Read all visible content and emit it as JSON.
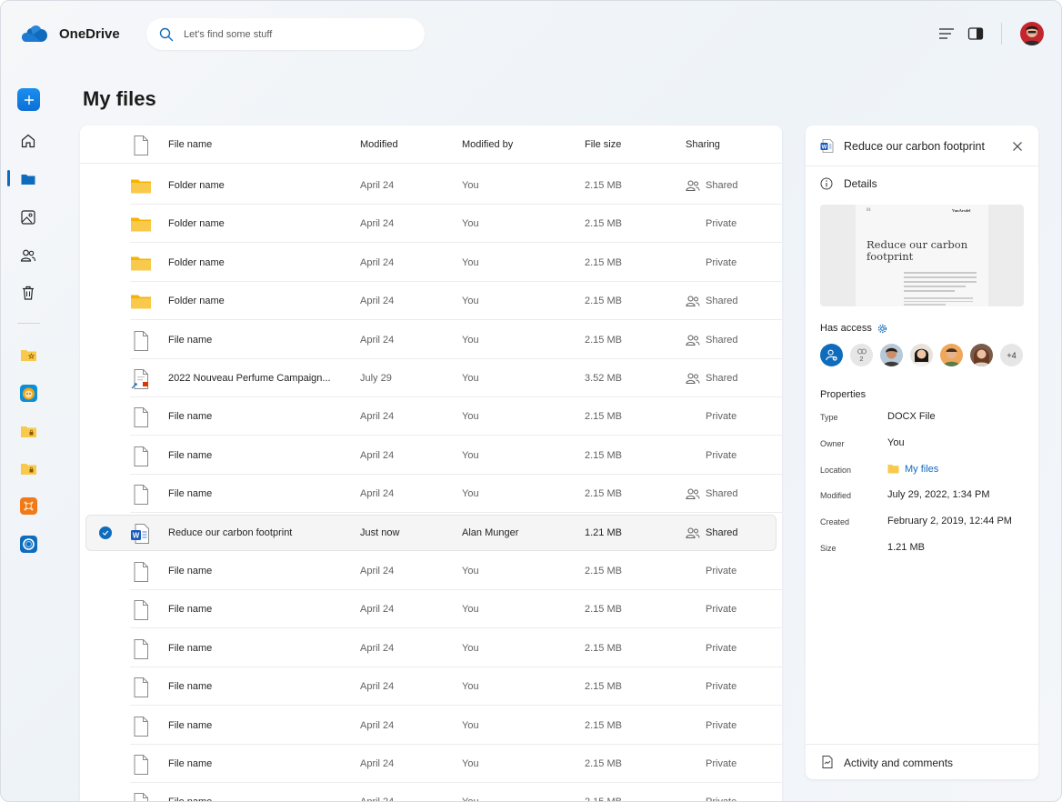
{
  "app": {
    "title": "OneDrive"
  },
  "search": {
    "placeholder": "Let's find some stuff"
  },
  "page": {
    "title": "My files"
  },
  "table": {
    "headers": {
      "name": "File name",
      "modified": "Modified",
      "modified_by": "Modified by",
      "size": "File size",
      "sharing": "Sharing"
    },
    "rows": [
      {
        "type": "folder",
        "name": "Folder name",
        "modified": "April 24",
        "by": "You",
        "size": "2.15 MB",
        "sharing": "Shared"
      },
      {
        "type": "folder",
        "name": "Folder name",
        "modified": "April 24",
        "by": "You",
        "size": "2.15 MB",
        "sharing": "Private"
      },
      {
        "type": "folder",
        "name": "Folder name",
        "modified": "April 24",
        "by": "You",
        "size": "2.15 MB",
        "sharing": "Private"
      },
      {
        "type": "folder",
        "name": "Folder name",
        "modified": "April 24",
        "by": "You",
        "size": "2.15 MB",
        "sharing": "Shared"
      },
      {
        "type": "file",
        "name": "File name",
        "modified": "April 24",
        "by": "You",
        "size": "2.15 MB",
        "sharing": "Shared"
      },
      {
        "type": "ppt",
        "name": "2022 Nouveau Perfume Campaign...",
        "modified": "July 29",
        "by": "You",
        "size": "3.52 MB",
        "sharing": "Shared"
      },
      {
        "type": "file",
        "name": "File name",
        "modified": "April 24",
        "by": "You",
        "size": "2.15 MB",
        "sharing": "Private"
      },
      {
        "type": "file",
        "name": "File name",
        "modified": "April 24",
        "by": "You",
        "size": "2.15 MB",
        "sharing": "Private"
      },
      {
        "type": "file",
        "name": "File name",
        "modified": "April 24",
        "by": "You",
        "size": "2.15 MB",
        "sharing": "Shared"
      },
      {
        "type": "word",
        "name": "Reduce our carbon footprint",
        "modified": "Just now",
        "by": "Alan Munger",
        "size": "1.21 MB",
        "sharing": "Shared",
        "selected": true
      },
      {
        "type": "file",
        "name": "File name",
        "modified": "April 24",
        "by": "You",
        "size": "2.15 MB",
        "sharing": "Private"
      },
      {
        "type": "file",
        "name": "File name",
        "modified": "April 24",
        "by": "You",
        "size": "2.15 MB",
        "sharing": "Private"
      },
      {
        "type": "file",
        "name": "File name",
        "modified": "April 24",
        "by": "You",
        "size": "2.15 MB",
        "sharing": "Private"
      },
      {
        "type": "file",
        "name": "File name",
        "modified": "April 24",
        "by": "You",
        "size": "2.15 MB",
        "sharing": "Private"
      },
      {
        "type": "file",
        "name": "File name",
        "modified": "April 24",
        "by": "You",
        "size": "2.15 MB",
        "sharing": "Private"
      },
      {
        "type": "file",
        "name": "File name",
        "modified": "April 24",
        "by": "You",
        "size": "2.15 MB",
        "sharing": "Private"
      },
      {
        "type": "file",
        "name": "File name",
        "modified": "April 24",
        "by": "You",
        "size": "2.15 MB",
        "sharing": "Private"
      }
    ]
  },
  "pane": {
    "title": "Reduce our carbon footprint",
    "details_label": "Details",
    "preview": {
      "page_number": "01",
      "brand": "VanArsdel",
      "title": "Reduce our carbon footprint"
    },
    "has_access_label": "Has access",
    "access": {
      "link_count": "2",
      "more": "+4"
    },
    "properties_label": "Properties",
    "properties": [
      {
        "key": "Type",
        "value": "DOCX File"
      },
      {
        "key": "Owner",
        "value": "You"
      },
      {
        "key": "Location",
        "value": "My files",
        "link": true
      },
      {
        "key": "Modified",
        "value": "July 29, 2022, 1:34 PM"
      },
      {
        "key": "Created",
        "value": "February 2, 2019, 12:44 PM"
      },
      {
        "key": "Size",
        "value": "1.21 MB"
      }
    ],
    "activity_label": "Activity and comments"
  },
  "colors": {
    "accent": "#0f6cbd",
    "folder": "#f8c94a",
    "new_button": "#1a8ff0"
  }
}
